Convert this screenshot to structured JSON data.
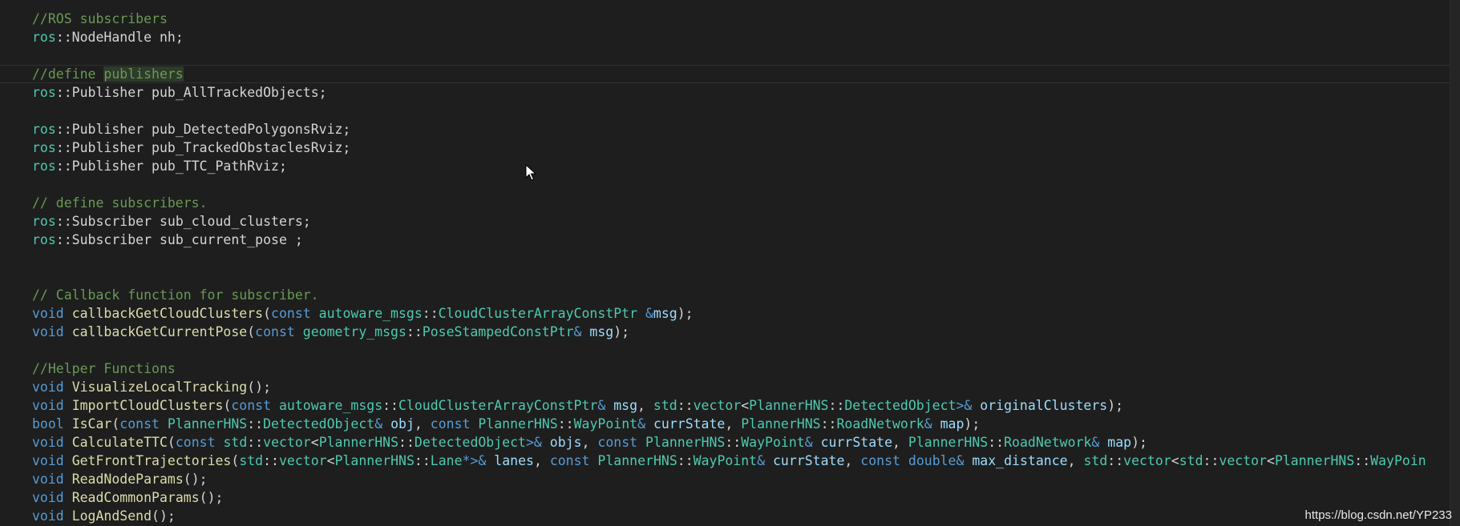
{
  "editor": {
    "colors": {
      "background": "#1e1e1e",
      "comment": "#6a9955",
      "namespace_type": "#4ec9b0",
      "keyword": "#569cd6",
      "function": "#dcdcaa",
      "variable": "#9cdcfe",
      "text": "#d4d4d4"
    },
    "lines": [
      [
        {
          "t": "//ROS subscribers",
          "c": "c"
        }
      ],
      [
        {
          "t": "ros",
          "c": "ns"
        },
        {
          "t": "::NodeHandle nh;",
          "c": "p"
        }
      ],
      [],
      [
        {
          "t": "//define ",
          "c": "c"
        },
        {
          "t": "publishers",
          "c": "c",
          "hl": true
        }
      ],
      [
        {
          "t": "ros",
          "c": "ns"
        },
        {
          "t": "::Publisher pub_AllTrackedObjects;",
          "c": "p"
        }
      ],
      [],
      [
        {
          "t": "ros",
          "c": "ns"
        },
        {
          "t": "::Publisher pub_DetectedPolygonsRviz;",
          "c": "p"
        }
      ],
      [
        {
          "t": "ros",
          "c": "ns"
        },
        {
          "t": "::Publisher pub_TrackedObstaclesRviz;",
          "c": "p"
        }
      ],
      [
        {
          "t": "ros",
          "c": "ns"
        },
        {
          "t": "::Publisher pub_TTC_PathRviz;",
          "c": "p"
        }
      ],
      [],
      [
        {
          "t": "// define subscribers.",
          "c": "c"
        }
      ],
      [
        {
          "t": "ros",
          "c": "ns"
        },
        {
          "t": "::Subscriber sub_cloud_clusters;",
          "c": "p"
        }
      ],
      [
        {
          "t": "ros",
          "c": "ns"
        },
        {
          "t": "::Subscriber sub_current_pose ;",
          "c": "p"
        }
      ],
      [],
      [],
      [
        {
          "t": "// Callback function for subscriber.",
          "c": "c"
        }
      ],
      [
        {
          "t": "void",
          "c": "kw"
        },
        {
          "t": " ",
          "c": "p"
        },
        {
          "t": "callbackGetCloudClusters",
          "c": "fn"
        },
        {
          "t": "(",
          "c": "p"
        },
        {
          "t": "const",
          "c": "kw"
        },
        {
          "t": " ",
          "c": "p"
        },
        {
          "t": "autoware_msgs",
          "c": "ns"
        },
        {
          "t": "::",
          "c": "p"
        },
        {
          "t": "CloudClusterArrayConstPtr",
          "c": "ty"
        },
        {
          "t": " &",
          "c": "kw"
        },
        {
          "t": "msg",
          "c": "va"
        },
        {
          "t": ");",
          "c": "p"
        }
      ],
      [
        {
          "t": "void",
          "c": "kw"
        },
        {
          "t": " ",
          "c": "p"
        },
        {
          "t": "callbackGetCurrentPose",
          "c": "fn"
        },
        {
          "t": "(",
          "c": "p"
        },
        {
          "t": "const",
          "c": "kw"
        },
        {
          "t": " ",
          "c": "p"
        },
        {
          "t": "geometry_msgs",
          "c": "ns"
        },
        {
          "t": "::",
          "c": "p"
        },
        {
          "t": "PoseStampedConstPtr",
          "c": "ty"
        },
        {
          "t": "&",
          "c": "kw"
        },
        {
          "t": " ",
          "c": "p"
        },
        {
          "t": "msg",
          "c": "va"
        },
        {
          "t": ");",
          "c": "p"
        }
      ],
      [],
      [
        {
          "t": "//Helper Functions",
          "c": "c"
        }
      ],
      [
        {
          "t": "void",
          "c": "kw"
        },
        {
          "t": " ",
          "c": "p"
        },
        {
          "t": "VisualizeLocalTracking",
          "c": "fn"
        },
        {
          "t": "();",
          "c": "p"
        }
      ],
      [
        {
          "t": "void",
          "c": "kw"
        },
        {
          "t": " ",
          "c": "p"
        },
        {
          "t": "ImportCloudClusters",
          "c": "fn"
        },
        {
          "t": "(",
          "c": "p"
        },
        {
          "t": "const",
          "c": "kw"
        },
        {
          "t": " ",
          "c": "p"
        },
        {
          "t": "autoware_msgs",
          "c": "ns"
        },
        {
          "t": "::",
          "c": "p"
        },
        {
          "t": "CloudClusterArrayConstPtr",
          "c": "ty"
        },
        {
          "t": "&",
          "c": "kw"
        },
        {
          "t": " ",
          "c": "p"
        },
        {
          "t": "msg",
          "c": "va"
        },
        {
          "t": ", ",
          "c": "p"
        },
        {
          "t": "std",
          "c": "ns"
        },
        {
          "t": "::",
          "c": "p"
        },
        {
          "t": "vector",
          "c": "ty"
        },
        {
          "t": "<",
          "c": "p"
        },
        {
          "t": "PlannerHNS",
          "c": "ns"
        },
        {
          "t": "::",
          "c": "p"
        },
        {
          "t": "DetectedObject",
          "c": "ty"
        },
        {
          "t": ">&",
          "c": "kw"
        },
        {
          "t": " ",
          "c": "p"
        },
        {
          "t": "originalClusters",
          "c": "va"
        },
        {
          "t": ");",
          "c": "p"
        }
      ],
      [
        {
          "t": "bool",
          "c": "kw"
        },
        {
          "t": " ",
          "c": "p"
        },
        {
          "t": "IsCar",
          "c": "fn"
        },
        {
          "t": "(",
          "c": "p"
        },
        {
          "t": "const",
          "c": "kw"
        },
        {
          "t": " ",
          "c": "p"
        },
        {
          "t": "PlannerHNS",
          "c": "ns"
        },
        {
          "t": "::",
          "c": "p"
        },
        {
          "t": "DetectedObject",
          "c": "ty"
        },
        {
          "t": "&",
          "c": "kw"
        },
        {
          "t": " ",
          "c": "p"
        },
        {
          "t": "obj",
          "c": "va"
        },
        {
          "t": ", ",
          "c": "p"
        },
        {
          "t": "const",
          "c": "kw"
        },
        {
          "t": " ",
          "c": "p"
        },
        {
          "t": "PlannerHNS",
          "c": "ns"
        },
        {
          "t": "::",
          "c": "p"
        },
        {
          "t": "WayPoint",
          "c": "ty"
        },
        {
          "t": "&",
          "c": "kw"
        },
        {
          "t": " ",
          "c": "p"
        },
        {
          "t": "currState",
          "c": "va"
        },
        {
          "t": ", ",
          "c": "p"
        },
        {
          "t": "PlannerHNS",
          "c": "ns"
        },
        {
          "t": "::",
          "c": "p"
        },
        {
          "t": "RoadNetwork",
          "c": "ty"
        },
        {
          "t": "&",
          "c": "kw"
        },
        {
          "t": " ",
          "c": "p"
        },
        {
          "t": "map",
          "c": "va"
        },
        {
          "t": ");",
          "c": "p"
        }
      ],
      [
        {
          "t": "void",
          "c": "kw"
        },
        {
          "t": " ",
          "c": "p"
        },
        {
          "t": "CalculateTTC",
          "c": "fn"
        },
        {
          "t": "(",
          "c": "p"
        },
        {
          "t": "const",
          "c": "kw"
        },
        {
          "t": " ",
          "c": "p"
        },
        {
          "t": "std",
          "c": "ns"
        },
        {
          "t": "::",
          "c": "p"
        },
        {
          "t": "vector",
          "c": "ty"
        },
        {
          "t": "<",
          "c": "p"
        },
        {
          "t": "PlannerHNS",
          "c": "ns"
        },
        {
          "t": "::",
          "c": "p"
        },
        {
          "t": "DetectedObject",
          "c": "ty"
        },
        {
          "t": ">&",
          "c": "kw"
        },
        {
          "t": " ",
          "c": "p"
        },
        {
          "t": "objs",
          "c": "va"
        },
        {
          "t": ", ",
          "c": "p"
        },
        {
          "t": "const",
          "c": "kw"
        },
        {
          "t": " ",
          "c": "p"
        },
        {
          "t": "PlannerHNS",
          "c": "ns"
        },
        {
          "t": "::",
          "c": "p"
        },
        {
          "t": "WayPoint",
          "c": "ty"
        },
        {
          "t": "&",
          "c": "kw"
        },
        {
          "t": " ",
          "c": "p"
        },
        {
          "t": "currState",
          "c": "va"
        },
        {
          "t": ", ",
          "c": "p"
        },
        {
          "t": "PlannerHNS",
          "c": "ns"
        },
        {
          "t": "::",
          "c": "p"
        },
        {
          "t": "RoadNetwork",
          "c": "ty"
        },
        {
          "t": "&",
          "c": "kw"
        },
        {
          "t": " ",
          "c": "p"
        },
        {
          "t": "map",
          "c": "va"
        },
        {
          "t": ");",
          "c": "p"
        }
      ],
      [
        {
          "t": "void",
          "c": "kw"
        },
        {
          "t": " ",
          "c": "p"
        },
        {
          "t": "GetFrontTrajectories",
          "c": "fn"
        },
        {
          "t": "(",
          "c": "p"
        },
        {
          "t": "std",
          "c": "ns"
        },
        {
          "t": "::",
          "c": "p"
        },
        {
          "t": "vector",
          "c": "ty"
        },
        {
          "t": "<",
          "c": "p"
        },
        {
          "t": "PlannerHNS",
          "c": "ns"
        },
        {
          "t": "::",
          "c": "p"
        },
        {
          "t": "Lane",
          "c": "ty"
        },
        {
          "t": "*>&",
          "c": "kw"
        },
        {
          "t": " ",
          "c": "p"
        },
        {
          "t": "lanes",
          "c": "va"
        },
        {
          "t": ", ",
          "c": "p"
        },
        {
          "t": "const",
          "c": "kw"
        },
        {
          "t": " ",
          "c": "p"
        },
        {
          "t": "PlannerHNS",
          "c": "ns"
        },
        {
          "t": "::",
          "c": "p"
        },
        {
          "t": "WayPoint",
          "c": "ty"
        },
        {
          "t": "&",
          "c": "kw"
        },
        {
          "t": " ",
          "c": "p"
        },
        {
          "t": "currState",
          "c": "va"
        },
        {
          "t": ", ",
          "c": "p"
        },
        {
          "t": "const",
          "c": "kw"
        },
        {
          "t": " ",
          "c": "p"
        },
        {
          "t": "double",
          "c": "kw"
        },
        {
          "t": "&",
          "c": "kw"
        },
        {
          "t": " ",
          "c": "p"
        },
        {
          "t": "max_distance",
          "c": "va"
        },
        {
          "t": ", ",
          "c": "p"
        },
        {
          "t": "std",
          "c": "ns"
        },
        {
          "t": "::",
          "c": "p"
        },
        {
          "t": "vector",
          "c": "ty"
        },
        {
          "t": "<",
          "c": "p"
        },
        {
          "t": "std",
          "c": "ns"
        },
        {
          "t": "::",
          "c": "p"
        },
        {
          "t": "vector",
          "c": "ty"
        },
        {
          "t": "<",
          "c": "p"
        },
        {
          "t": "PlannerHNS",
          "c": "ns"
        },
        {
          "t": "::",
          "c": "p"
        },
        {
          "t": "WayPoin",
          "c": "ty"
        }
      ],
      [
        {
          "t": "void",
          "c": "kw"
        },
        {
          "t": " ",
          "c": "p"
        },
        {
          "t": "ReadNodeParams",
          "c": "fn"
        },
        {
          "t": "();",
          "c": "p"
        }
      ],
      [
        {
          "t": "void",
          "c": "kw"
        },
        {
          "t": " ",
          "c": "p"
        },
        {
          "t": "ReadCommonParams",
          "c": "fn"
        },
        {
          "t": "();",
          "c": "p"
        }
      ],
      [
        {
          "t": "void",
          "c": "kw"
        },
        {
          "t": " ",
          "c": "p"
        },
        {
          "t": "LogAndSend",
          "c": "fn"
        },
        {
          "t": "();",
          "c": "p"
        }
      ]
    ],
    "current_line_index": 3
  },
  "watermark": {
    "text": "https://blog.csdn.net/YP233"
  },
  "icons": {
    "cursor": "mouse-pointer-icon"
  }
}
